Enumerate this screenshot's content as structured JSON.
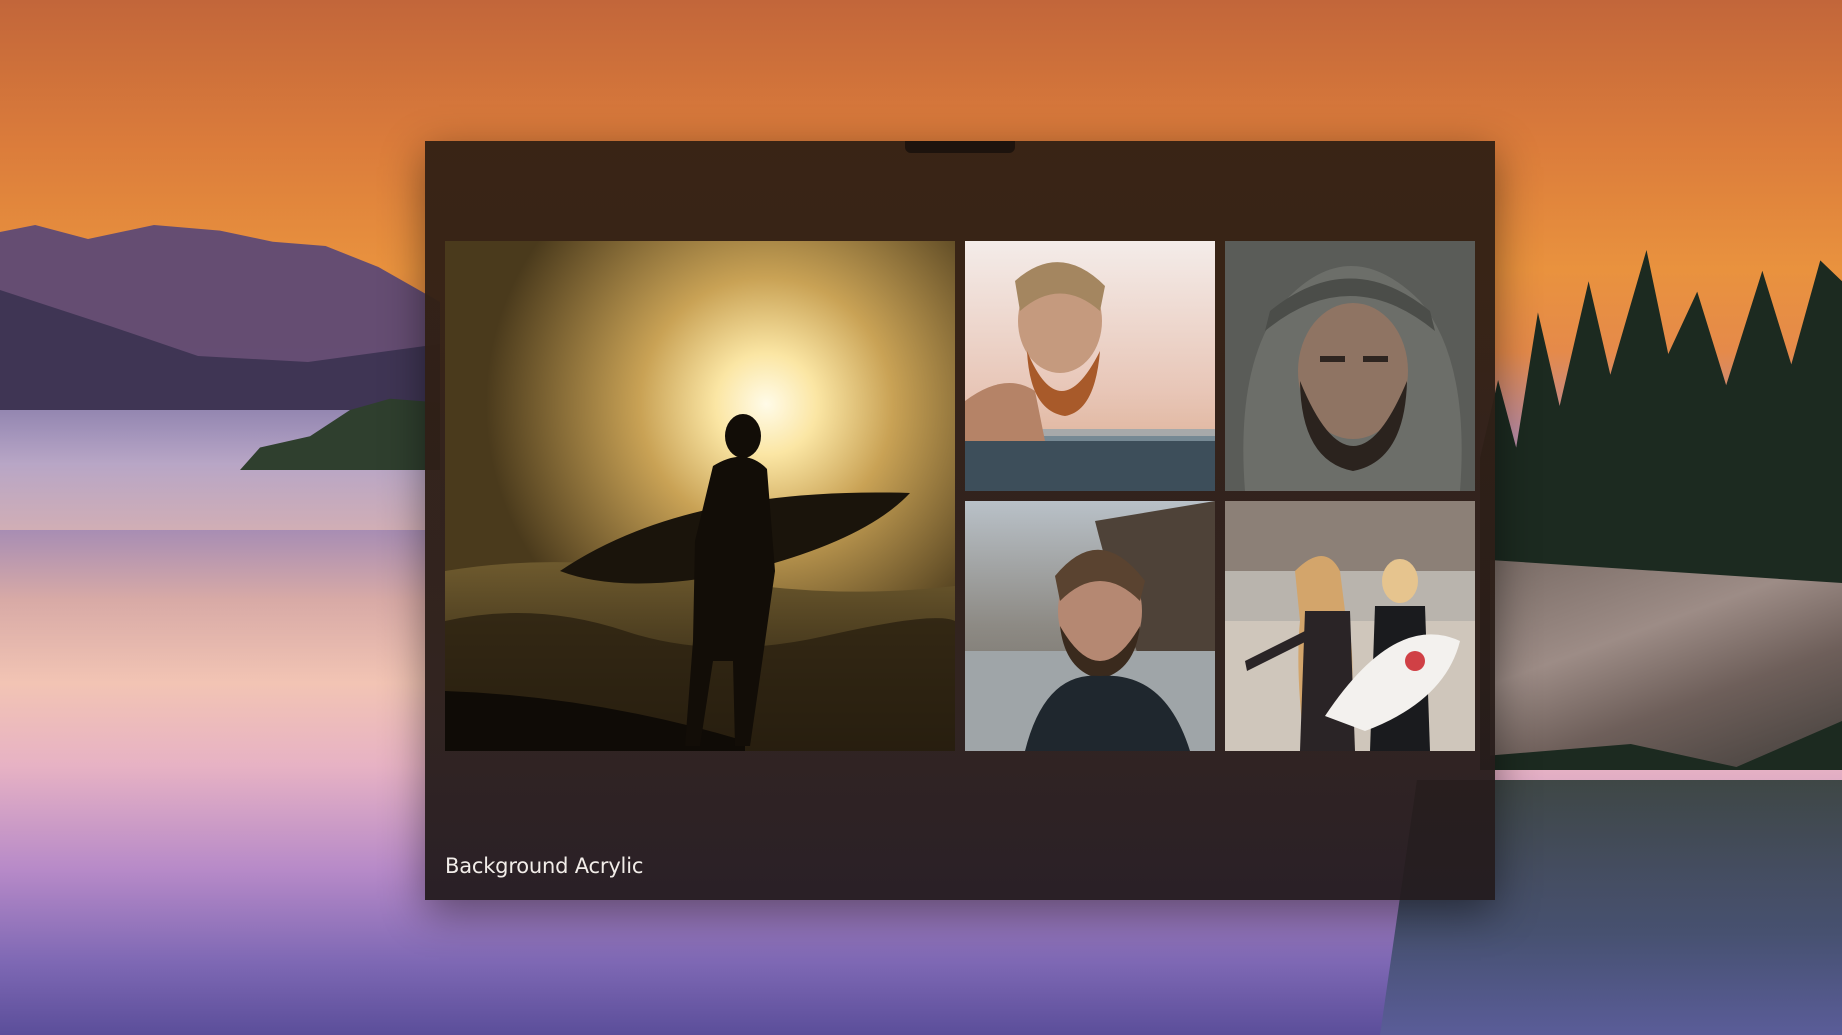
{
  "window": {
    "caption": "Background Acrylic"
  },
  "gallery": {
    "photos": [
      {
        "name": "surfer-silhouette-sunset"
      },
      {
        "name": "bearded-man-in-water"
      },
      {
        "name": "bearded-man-in-hood"
      },
      {
        "name": "bearded-man-on-beach"
      },
      {
        "name": "surfers-on-beach"
      }
    ]
  },
  "colors": {
    "window_tint": "#2e1f17",
    "sky_orange": "#e58a3e",
    "caption_text": "#f2ede9"
  }
}
